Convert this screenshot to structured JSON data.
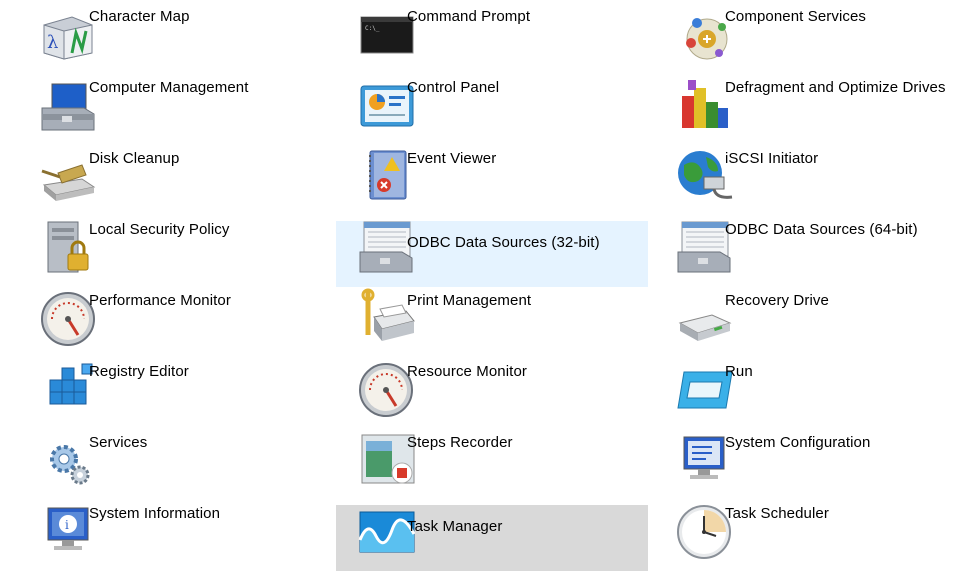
{
  "tools": [
    {
      "label": "Character Map",
      "icon": "character-map-icon"
    },
    {
      "label": "Command Prompt",
      "icon": "command-prompt-icon"
    },
    {
      "label": "Component Services",
      "icon": "component-services-icon"
    },
    {
      "label": "Computer Management",
      "icon": "computer-management-icon"
    },
    {
      "label": "Control Panel",
      "icon": "control-panel-icon"
    },
    {
      "label": "Defragment and Optimize Drives",
      "icon": "defragment-icon"
    },
    {
      "label": "Disk Cleanup",
      "icon": "disk-cleanup-icon"
    },
    {
      "label": "Event Viewer",
      "icon": "event-viewer-icon"
    },
    {
      "label": "iSCSI Initiator",
      "icon": "iscsi-initiator-icon"
    },
    {
      "label": "Local Security Policy",
      "icon": "local-security-policy-icon"
    },
    {
      "label": "ODBC Data Sources (32-bit)",
      "icon": "odbc-32-icon",
      "state": "hover"
    },
    {
      "label": "ODBC Data Sources (64-bit)",
      "icon": "odbc-64-icon"
    },
    {
      "label": "Performance Monitor",
      "icon": "performance-monitor-icon"
    },
    {
      "label": "Print Management",
      "icon": "print-management-icon"
    },
    {
      "label": "Recovery Drive",
      "icon": "recovery-drive-icon"
    },
    {
      "label": "Registry Editor",
      "icon": "registry-editor-icon"
    },
    {
      "label": "Resource Monitor",
      "icon": "resource-monitor-icon"
    },
    {
      "label": "Run",
      "icon": "run-icon"
    },
    {
      "label": "Services",
      "icon": "services-icon"
    },
    {
      "label": "Steps Recorder",
      "icon": "steps-recorder-icon"
    },
    {
      "label": "System Configuration",
      "icon": "system-configuration-icon"
    },
    {
      "label": "System Information",
      "icon": "system-information-icon"
    },
    {
      "label": "Task Manager",
      "icon": "task-manager-icon",
      "state": "selected"
    },
    {
      "label": "Task Scheduler",
      "icon": "task-scheduler-icon"
    }
  ],
  "colors": {
    "hover_background": "#e5f3ff",
    "selected_background": "#d9d9d9",
    "text": "#000000"
  }
}
